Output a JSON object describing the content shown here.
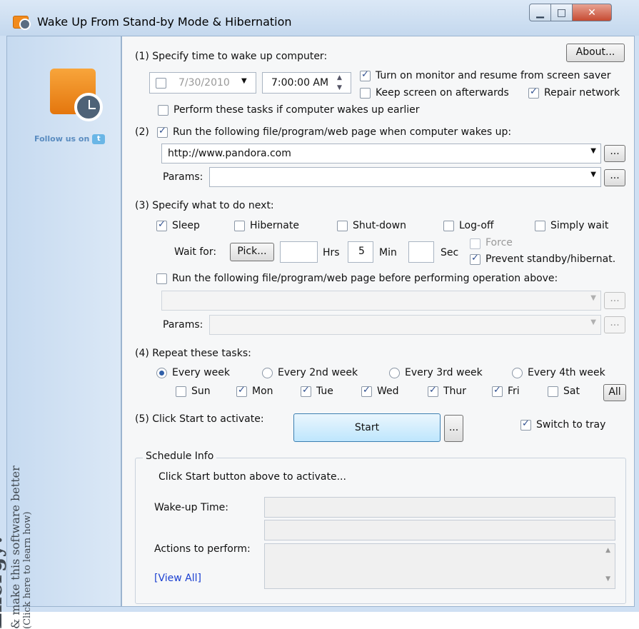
{
  "window": {
    "title": "Wake Up From Stand-by Mode & Hibernation",
    "min_icon": "minimize-icon",
    "max_icon": "maximize-icon",
    "close_icon": "close-icon"
  },
  "sidebar": {
    "follow_text": "Follow us on",
    "energy_line1": "Let's Save Energy!",
    "energy_line2": "& make this software better",
    "energy_line3": "(Click here to learn how)"
  },
  "about_label": "About...",
  "step1": {
    "label": "(1) Specify time to wake up computer:",
    "date": "7/30/2010",
    "time": "7:00:00 AM",
    "turn_on_monitor": "Turn on monitor and resume from screen saver",
    "keep_screen": "Keep screen on afterwards",
    "repair_network": "Repair network",
    "perform_earlier": "Perform these tasks if computer wakes up earlier"
  },
  "step2": {
    "label": "(2)",
    "run_label": "Run the following file/program/web page when computer wakes up:",
    "url": "http://www.pandora.com",
    "params_label": "Params:",
    "browse": "..."
  },
  "step3": {
    "label": "(3) Specify what to do next:",
    "sleep": "Sleep",
    "hibernate": "Hibernate",
    "shutdown": "Shut-down",
    "logoff": "Log-off",
    "simply_wait": "Simply wait",
    "wait_for": "Wait for:",
    "pick": "Pick...",
    "hrs": "Hrs",
    "min_value": "5",
    "min": "Min",
    "sec": "Sec",
    "force": "Force",
    "prevent": "Prevent standby/hibernat.",
    "run_before": "Run the following file/program/web page before performing operation above:",
    "params_label": "Params:",
    "browse": "..."
  },
  "step4": {
    "label": "(4) Repeat these tasks:",
    "every_week": "Every week",
    "every_2nd": "Every 2nd week",
    "every_3rd": "Every 3rd week",
    "every_4th": "Every 4th week",
    "days": [
      "Sun",
      "Mon",
      "Tue",
      "Wed",
      "Thur",
      "Fri",
      "Sat"
    ],
    "all": "All"
  },
  "step5": {
    "label": "(5) Click Start to activate:",
    "start": "Start",
    "more": "...",
    "tray": "Switch to tray"
  },
  "schedule": {
    "title": "Schedule Info",
    "message": "Click Start button above to activate...",
    "wake_time": "Wake-up Time:",
    "actions": "Actions to perform:",
    "view_all": "[View All]"
  }
}
